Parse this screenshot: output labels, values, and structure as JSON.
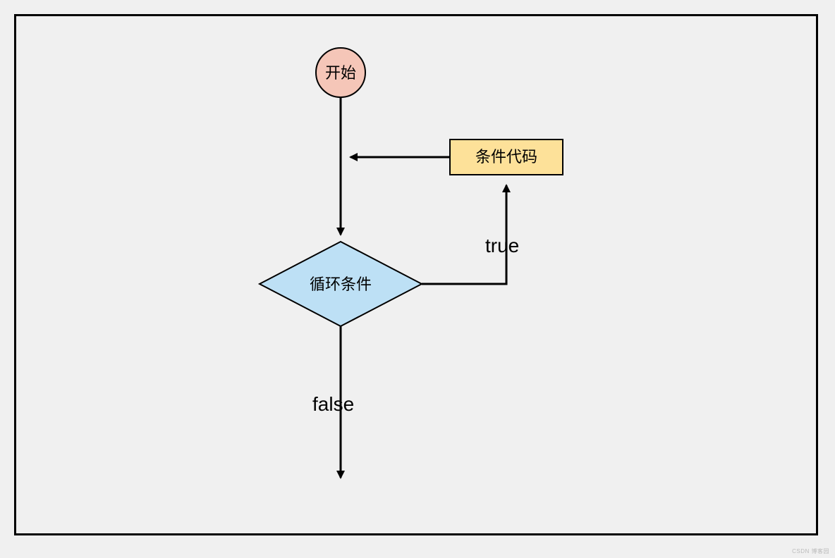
{
  "nodes": {
    "start": {
      "label": "开始"
    },
    "condition_code": {
      "label": "条件代码"
    },
    "loop_condition": {
      "label": "循环条件"
    }
  },
  "edges": {
    "true_label": "true",
    "false_label": "false"
  },
  "colors": {
    "start_fill": "#f5c6b8",
    "code_fill": "#fde199",
    "condition_fill": "#bde0f5",
    "stroke": "#000000",
    "background": "#f0f0f0"
  },
  "watermark": "CSDN 博客园"
}
